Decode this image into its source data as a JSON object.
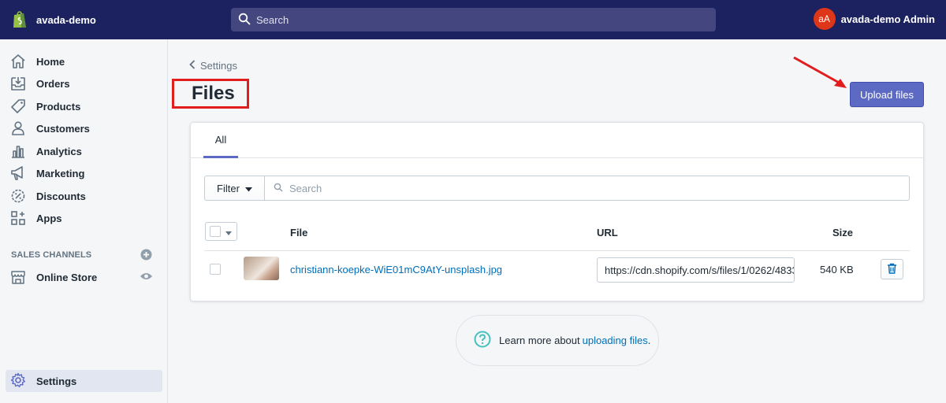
{
  "topbar": {
    "store_name": "avada-demo",
    "search_placeholder": "Search",
    "avatar_initials": "aA",
    "user_name": "avada-demo Admin"
  },
  "sidebar": {
    "items": [
      {
        "label": "Home",
        "icon": "home-icon"
      },
      {
        "label": "Orders",
        "icon": "orders-icon"
      },
      {
        "label": "Products",
        "icon": "tag-icon"
      },
      {
        "label": "Customers",
        "icon": "person-icon"
      },
      {
        "label": "Analytics",
        "icon": "bar-chart-icon"
      },
      {
        "label": "Marketing",
        "icon": "megaphone-icon"
      },
      {
        "label": "Discounts",
        "icon": "discount-icon"
      },
      {
        "label": "Apps",
        "icon": "apps-icon"
      }
    ],
    "sales_channels_title": "SALES CHANNELS",
    "online_store_label": "Online Store",
    "settings_label": "Settings"
  },
  "main": {
    "breadcrumb": "Settings",
    "title": "Files",
    "upload_button": "Upload files",
    "tabs": [
      {
        "label": "All"
      }
    ],
    "filter_label": "Filter",
    "search_placeholder": "Search",
    "columns": {
      "file": "File",
      "url": "URL",
      "size": "Size"
    },
    "rows": [
      {
        "file_name": "christiann-koepke-WiE01mC9AtY-unsplash.jpg",
        "url": "https://cdn.shopify.com/s/files/1/0262/4833",
        "size": "540 KB"
      }
    ],
    "learn_prefix": "Learn more about ",
    "learn_link": "uploading files",
    "learn_suffix": "."
  },
  "colors": {
    "topbar": "#1c2260",
    "accent": "#5c6ac4",
    "link": "#006fbb",
    "highlight": "#e11d1d"
  }
}
